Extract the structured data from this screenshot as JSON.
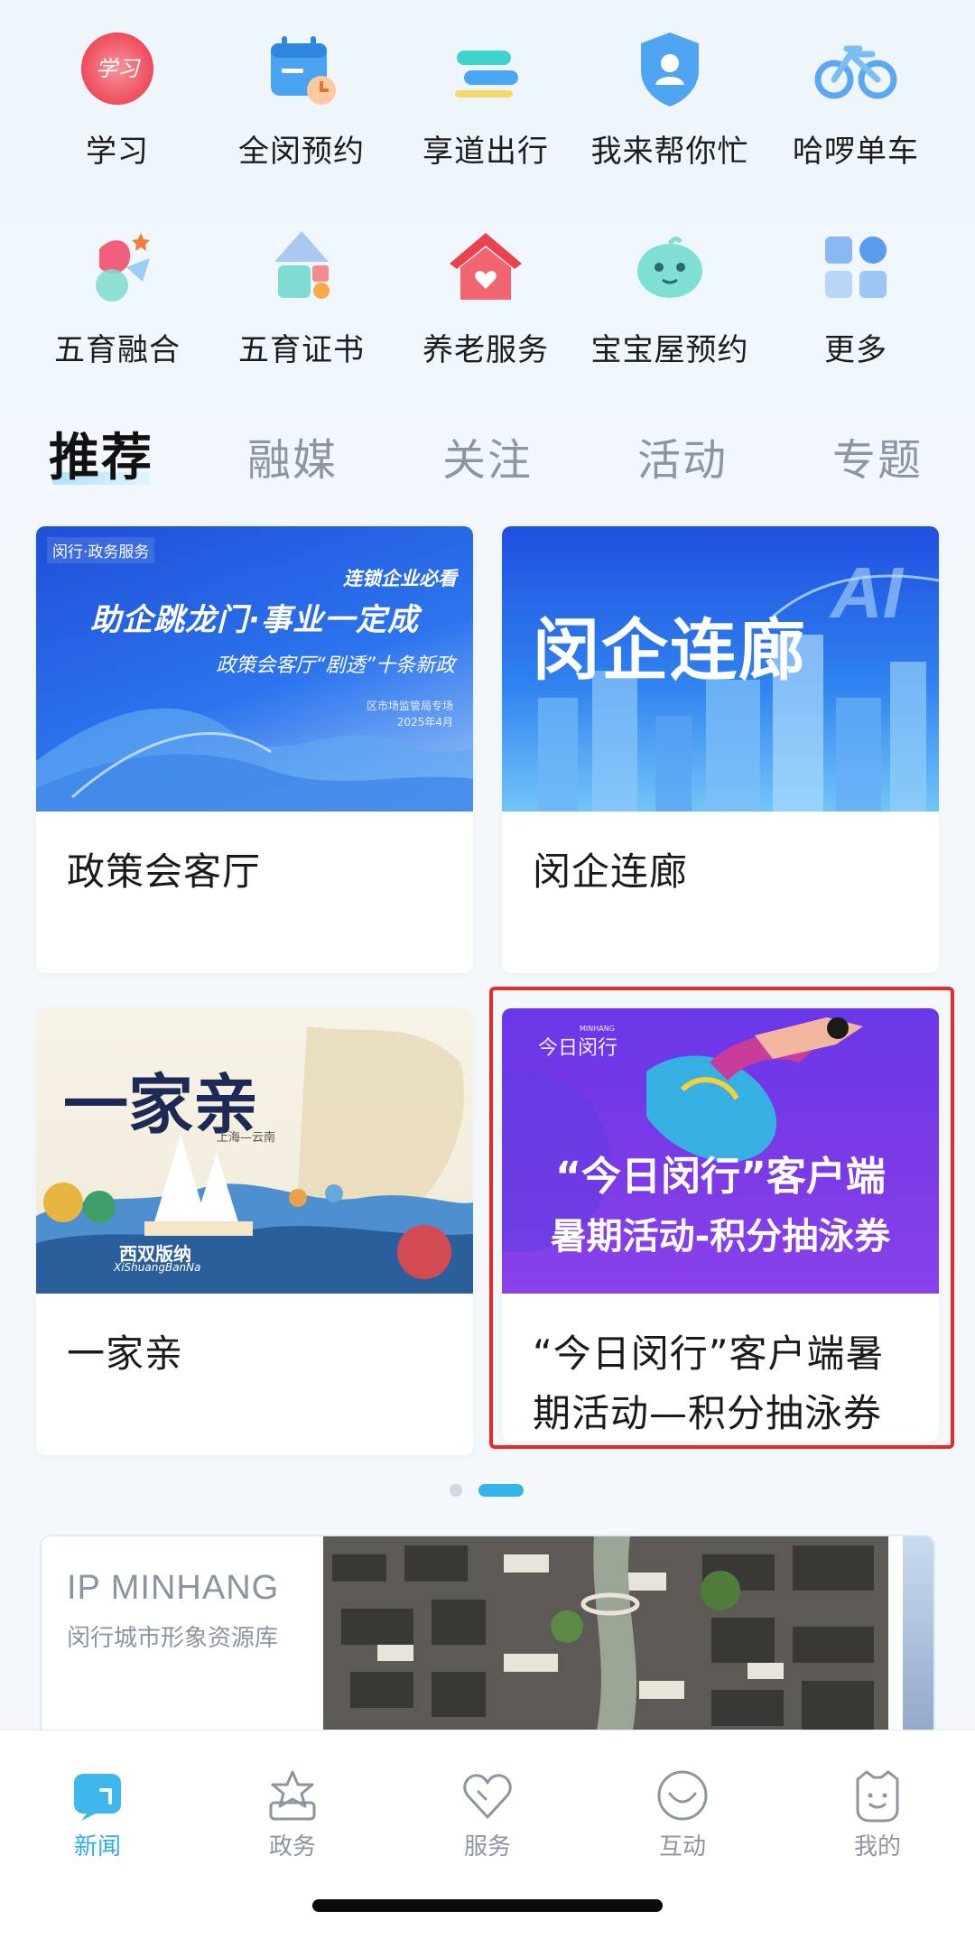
{
  "grid": {
    "row1": [
      {
        "label": "学习",
        "icon": "xuexi-icon"
      },
      {
        "label": "全闵预约",
        "icon": "calendar-icon"
      },
      {
        "label": "享道出行",
        "icon": "travel-icon"
      },
      {
        "label": "我来帮你忙",
        "icon": "shield-person-icon"
      },
      {
        "label": "哈啰单车",
        "icon": "bicycle-icon"
      }
    ],
    "row2": [
      {
        "label": "五育融合",
        "icon": "star-flower-icon"
      },
      {
        "label": "五育证书",
        "icon": "shapes-icon"
      },
      {
        "label": "养老服务",
        "icon": "home-heart-icon"
      },
      {
        "label": "宝宝屋预约",
        "icon": "baby-icon"
      },
      {
        "label": "更多",
        "icon": "more-grid-icon"
      }
    ]
  },
  "tabs": [
    {
      "label": "推荐",
      "active": true
    },
    {
      "label": "融媒",
      "active": false
    },
    {
      "label": "关注",
      "active": false
    },
    {
      "label": "活动",
      "active": false
    },
    {
      "label": "专题",
      "active": false
    }
  ],
  "cards": [
    {
      "title": "政策会客厅",
      "image": {
        "brand": "闵行·政务服务",
        "tag": "连锁企业必看",
        "headline": "助企跳龙门·事业一定成",
        "subline": "政策会客厅“剧透”十条新政",
        "footer1": "区市场监管局专场",
        "footer2": "2025年4月"
      }
    },
    {
      "title": "闵企连廊",
      "image": {
        "headline": "闵企连廊",
        "ai": "AI"
      }
    },
    {
      "title": "一家亲",
      "image": {
        "headline": "一家亲",
        "sub": "上海—云南",
        "place": "西双版纳",
        "place_en": "XiShuangBanNa"
      }
    },
    {
      "title": "“今日闵行”客户端暑期活动—积分抽泳券",
      "image": {
        "brand": "今日闵行",
        "brand_en": "MINHANG",
        "line1": "“今日闵行”客户端",
        "line2": "暑期活动-积分抽泳券"
      }
    }
  ],
  "banner": {
    "title": "IP  MINHANG",
    "subtitle": "闵行城市形象资源库"
  },
  "bottom_nav": [
    {
      "label": "新闻",
      "icon": "news-icon",
      "active": true
    },
    {
      "label": "政务",
      "icon": "government-icon",
      "active": false
    },
    {
      "label": "服务",
      "icon": "heart-service-icon",
      "active": false
    },
    {
      "label": "互动",
      "icon": "smile-interact-icon",
      "active": false
    },
    {
      "label": "我的",
      "icon": "profile-face-icon",
      "active": false
    }
  ],
  "colors": {
    "accent": "#2eaee6",
    "highlight": "#e8292a"
  }
}
